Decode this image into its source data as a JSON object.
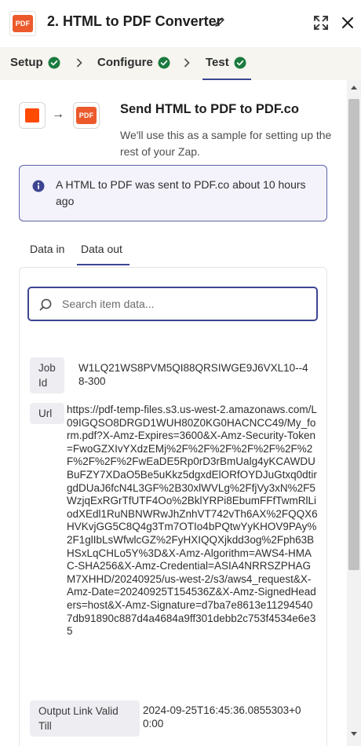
{
  "header": {
    "logo_text": "PDF",
    "title": "2. HTML to PDF Converter",
    "icons": {
      "edit": "pencil-icon",
      "expand": "expand-icon",
      "close": "close-icon"
    }
  },
  "tabs": [
    {
      "label": "Setup",
      "status": "complete"
    },
    {
      "label": "Configure",
      "status": "complete"
    },
    {
      "label": "Test",
      "status": "complete",
      "active": true
    }
  ],
  "step": {
    "title": "Send HTML to PDF to PDF.co",
    "description": "We'll use this as a sample for setting up the rest of your Zap.",
    "pdf_logo_text": "PDF"
  },
  "info": {
    "message": "A HTML to PDF was sent to PDF.co about 10 hours ago"
  },
  "data_tabs": [
    {
      "label": "Data in",
      "active": false
    },
    {
      "label": "Data out",
      "active": true
    }
  ],
  "search": {
    "placeholder": "Search item data...",
    "value": ""
  },
  "fields": [
    {
      "key": "Job Id",
      "value": "W1LQ21WS8PVM5QI88QRSIWGE9J6VXL10--48-300"
    },
    {
      "key": "Url",
      "value": "https://pdf-temp-files.s3.us-west-2.amazonaws.com/L09IGQSO8DRGD1WUH80Z0KG0HACNCC49/My_form.pdf?X-Amz-Expires=3600&X-Amz-Security-Token=FwoGZXIvYXdzEMj%2F%2F%2F%2F%2F%2F%2F%2F%2F%2FwEaDE5Rp0rD3rBmUalg4yKCAWDUBuFZY7XDaO5Be5uKkz5dgxdElORfOYDJuGtxq0dtirgdDUaJ6fcN4L3GF%2B30xlWVLg%2FfjVy3xN%2F5WzjqExRGrTfUTF4Oo%2BklYRPi8EbumFFfTwmRlLiodXEdl1RuNBNWRwJhZnhVT742vTh6AX%2FQQX6HVKvjGG5C8Q4g3Tm7OTIo4bPQtwYyKHOV9PAy%2F1glIbLsWfwlcGZ%2FyHXIQQXjkdd3og%2Fph63BHSxLqCHLo5Y%3D&X-Amz-Algorithm=AWS4-HMAC-SHA256&X-Amz-Credential=ASIA4NRRSZPHAGM7XHHD/20240925/us-west-2/s3/aws4_request&X-Amz-Date=20240925T154536Z&X-Amz-SignedHeaders=host&X-Amz-Signature=d7ba7e8613e112945407db91890c887d4a4684a9ff301debb2c753f4534e6e35"
    },
    {
      "key": "Output Link Valid Till",
      "value": "2024-09-25T16:45:36.0855303+00:00"
    }
  ],
  "colors": {
    "accent": "#3d4592",
    "brand_orange": "#ff4a00",
    "success": "#1b7a3f"
  }
}
